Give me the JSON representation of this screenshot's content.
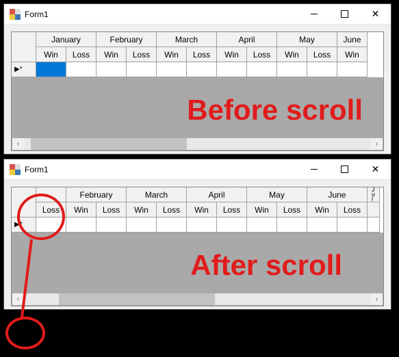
{
  "window_title": "Form1",
  "before": {
    "label": "Before scroll",
    "months": [
      "January",
      "February",
      "March",
      "April",
      "May",
      "June"
    ],
    "subs": [
      "Win",
      "Loss"
    ],
    "row_indicator": "▶*",
    "scroll": {
      "thumb_left_pct": 2,
      "thumb_width_pct": 45
    }
  },
  "after": {
    "label": "After scroll",
    "leading_sub": "Loss",
    "months": [
      "February",
      "March",
      "April",
      "May",
      "June"
    ],
    "trailing_month_fragment": "J u l",
    "subs": [
      "Win",
      "Loss"
    ],
    "row_indicator": "▶*",
    "scroll": {
      "thumb_left_pct": 10,
      "thumb_width_pct": 45
    }
  },
  "winbuttons": {
    "close_glyph": "✕"
  },
  "arrows": {
    "left": "‹",
    "right": "›"
  }
}
